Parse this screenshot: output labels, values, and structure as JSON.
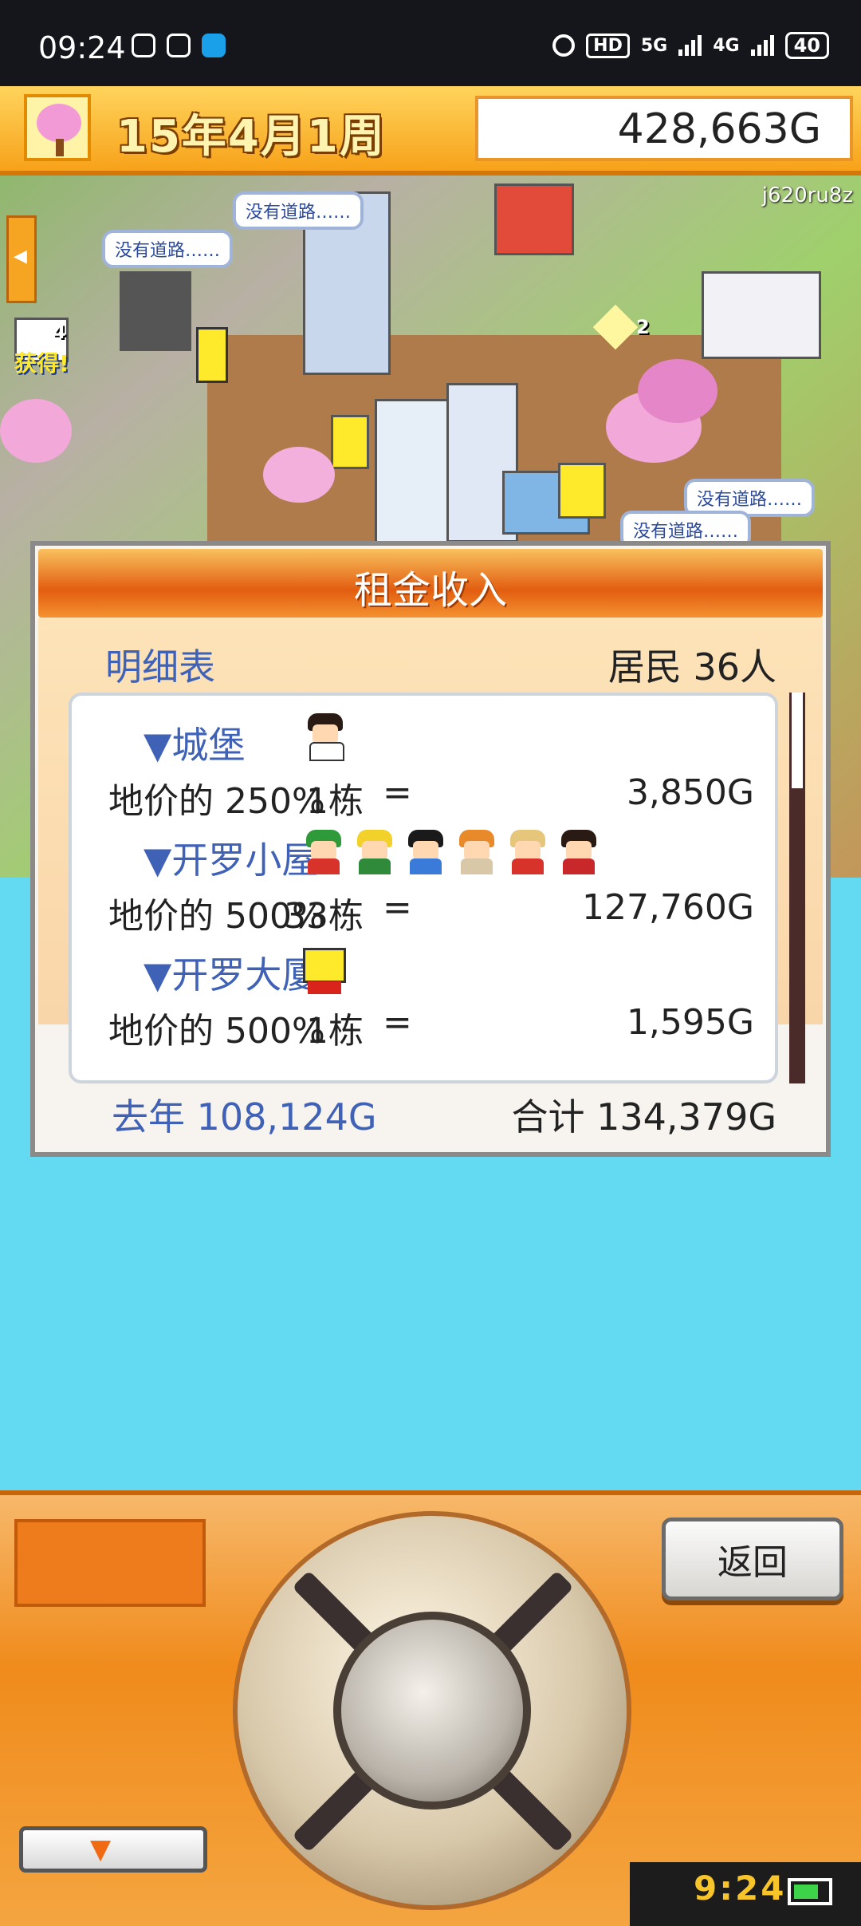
{
  "status_bar": {
    "time": "09:24",
    "network_1": "5G",
    "network_2": "4G",
    "battery": "40"
  },
  "header": {
    "date": "15年4月1周",
    "money": "428,663G"
  },
  "map": {
    "watermark_id": "j620ru8z",
    "no_road_label": "没有道路……",
    "counter_a": "4",
    "counter_b": "2",
    "obtain_label": "获得!"
  },
  "dialog": {
    "title": "租金收入",
    "detail_label": "明细表",
    "residents": "居民 36人",
    "rows": [
      {
        "name": "▼城堡",
        "detail": "地价的 250%",
        "count": "1栋",
        "eq": "=",
        "amount": "3,850G"
      },
      {
        "name": "▼开罗小屋",
        "detail": "地价的 500%",
        "count": "33栋",
        "eq": "=",
        "amount": "127,760G"
      },
      {
        "name": "▼开罗大厦",
        "detail": "地价的 500%",
        "count": "1栋",
        "eq": "=",
        "amount": "1,595G"
      }
    ],
    "last_year": "去年 108,124G",
    "total": "合计 134,379G"
  },
  "controls": {
    "back_label": "返回",
    "down_arrow": "▼",
    "clock": "9:24"
  }
}
